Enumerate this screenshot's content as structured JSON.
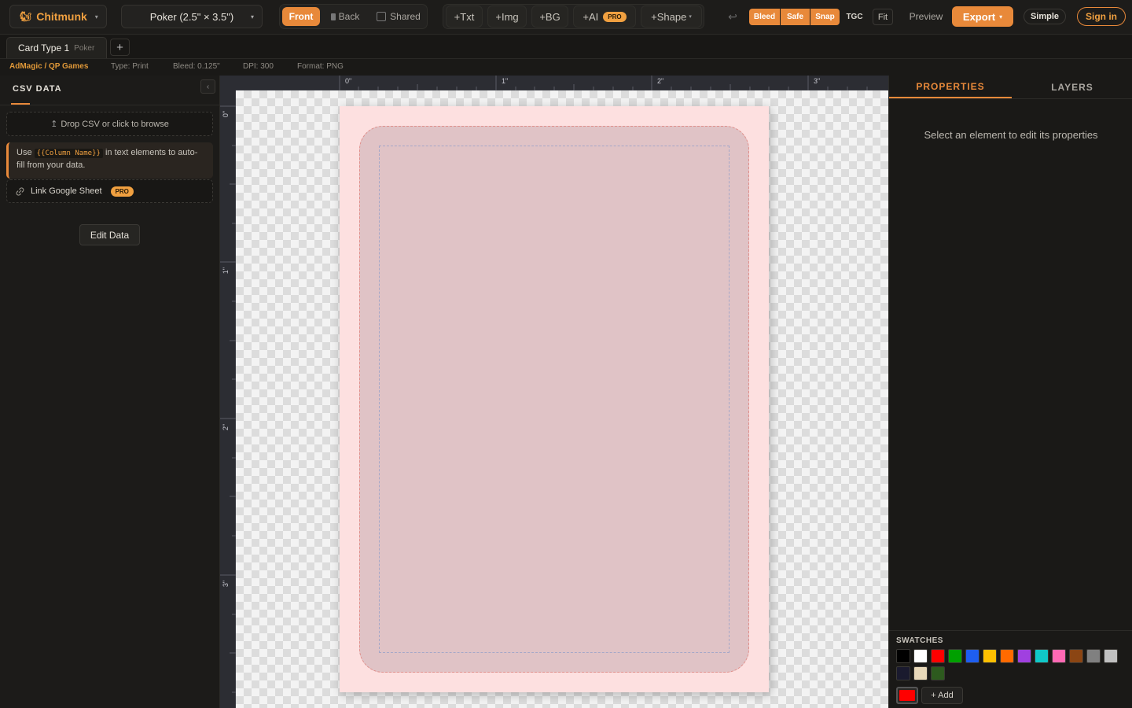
{
  "app": {
    "brand": "Chitmunk",
    "card_size": "Poker (2.5\" × 3.5\")",
    "accent": "#e8893a"
  },
  "toolbar": {
    "front": "Front",
    "back": "Back",
    "shared": "Shared",
    "add_text": "+Txt",
    "add_image": "+Img",
    "add_bg": "+BG",
    "add_ai": "+AI",
    "pro_badge": "PRO",
    "add_shape": "+Shape",
    "bleed": "Bleed",
    "safe": "Safe",
    "snap": "Snap",
    "tgc": "TGC",
    "fit": "Fit",
    "preview": "Preview",
    "export": "Export",
    "simple": "Simple",
    "sign_in": "Sign in"
  },
  "tabs": {
    "active": "Card Type 1",
    "active_sub": "Poker",
    "add": "+"
  },
  "info": {
    "breadcrumb": "AdMagic / QP Games",
    "type": "Type: Print",
    "bleed": "Bleed: 0.125\"",
    "dpi": "DPI: 300",
    "format": "Format: PNG"
  },
  "left_panel": {
    "title": "CSV DATA",
    "drop_label": "Drop CSV or click to browse",
    "hint_prefix": "Use",
    "hint_code": "{{Column Name}}",
    "hint_suffix": "in text elements to auto-fill from your data.",
    "google_sheet": "Link Google Sheet",
    "pro_badge": "PRO",
    "edit_data": "Edit Data"
  },
  "rulers": {
    "top": [
      "0\"",
      "1\"",
      "2\"",
      "3\""
    ],
    "left": [
      "0\"",
      "1\"",
      "2\"",
      "3\""
    ]
  },
  "right_panel": {
    "tab_properties": "PROPERTIES",
    "tab_layers": "LAYERS",
    "empty_message": "Select an element to edit its properties",
    "swatches_title": "SWATCHES",
    "add_swatch": "+ Add",
    "swatch_colors": [
      "#000000",
      "#ffffff",
      "#ff0000",
      "#00a000",
      "#1e5ef0",
      "#ffc000",
      "#ff6a00",
      "#a040e0",
      "#10c8c8",
      "#ff69b4",
      "#8b4513",
      "#808080",
      "#c0c0c0",
      "#1a1a2e",
      "#e8d8b8",
      "#2d5a1e"
    ],
    "current_color": "#ff0000"
  }
}
